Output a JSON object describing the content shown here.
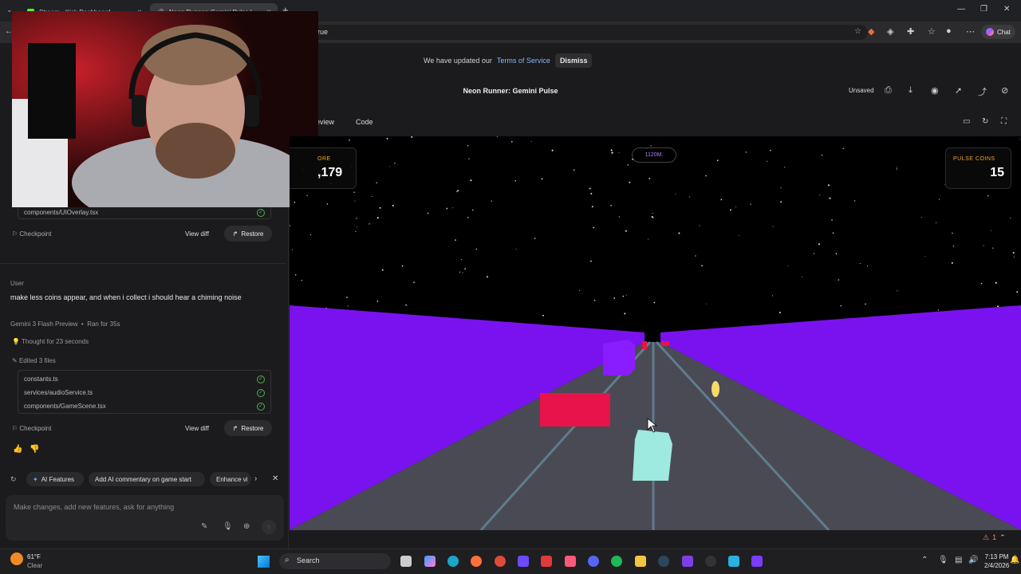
{
  "browser": {
    "tabs": [
      {
        "label": "Stream - Kick Dashboard"
      },
      {
        "label": "Neon Runner: Gemini Pulse | "
      }
    ],
    "url_fragment": "rue",
    "chat_label": "Chat"
  },
  "app": {
    "tos_text": "We have updated our",
    "tos_link": "Terms of Service",
    "dismiss_label": "Dismiss",
    "title": "Neon Runner: Gemini Pulse",
    "unsaved_label": "Unsaved",
    "preview_tab": "eview",
    "code_tab": "Code"
  },
  "chat": {
    "prev_file": "components/UIOverlay.tsx",
    "checkpoint_label": "Checkpoint",
    "view_diff_label": "View diff",
    "restore_label": "Restore",
    "user_role": "User",
    "user_message": "make less coins appear, and when i collect i should hear a chiming noise",
    "model_name": "Gemini 3 Flash Preview",
    "run_time": "Ran for 35s",
    "thought": "Thought for 23 seconds",
    "edited": "Edited 3 files",
    "files": [
      "constants.ts",
      "services/audioService.ts",
      "components/GameScene.tsx"
    ],
    "chips": [
      "AI Features",
      "Add AI commentary on game start",
      "Enhance vi"
    ],
    "prompt_placeholder": "Make changes, add new features, ask for anything"
  },
  "game": {
    "score_label": "ORE",
    "score_value": ",179",
    "distance": "1120M.",
    "coins_label": "PULSE COINS",
    "coins_value": "15"
  },
  "status": {
    "warnings": "1"
  },
  "taskbar": {
    "temp": "61°F",
    "condition": "Clear",
    "search_label": "Search",
    "time": "7:13 PM",
    "date": "2/4/2026"
  },
  "colors": {
    "wall": "#7a12f0",
    "road": "#4a4a55",
    "player": "#9ee9e0",
    "obstacle": "#e8134a",
    "accent": "#f5a623"
  }
}
